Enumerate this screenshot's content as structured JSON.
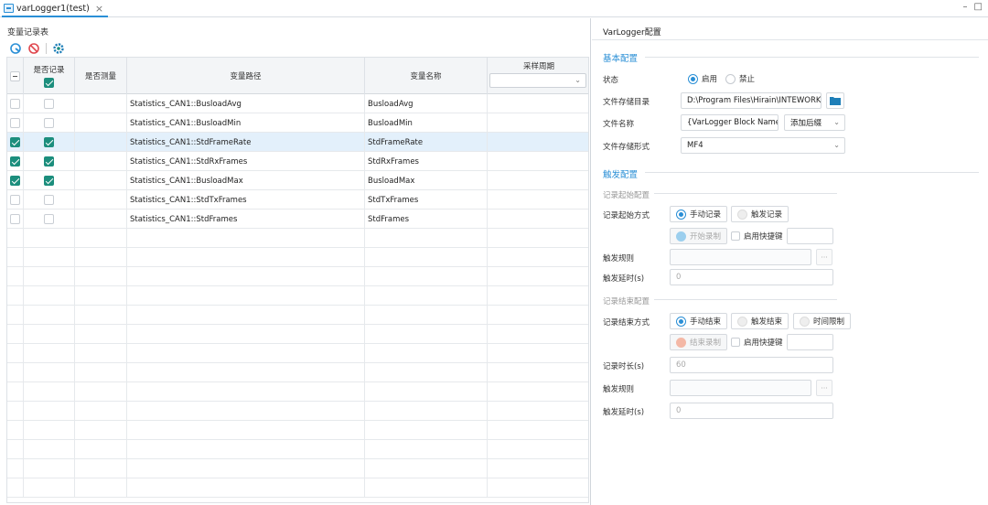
{
  "tab": {
    "title": "varLogger1(test)",
    "close": "×"
  },
  "window": {
    "minimize": "–",
    "maximize": "□"
  },
  "left": {
    "title": "变量记录表",
    "columns": {
      "record": "是否记录",
      "measure": "是否测量",
      "path": "变量路径",
      "name": "变量名称",
      "period": "采样周期"
    },
    "rows": [
      {
        "measure": false,
        "record": false,
        "path": "Statistics_CAN1::BusloadAvg",
        "name": "BusloadAvg",
        "selected": false
      },
      {
        "measure": false,
        "record": false,
        "path": "Statistics_CAN1::BusloadMin",
        "name": "BusloadMin",
        "selected": false
      },
      {
        "measure": true,
        "record": true,
        "path": "Statistics_CAN1::StdFrameRate",
        "name": "StdFrameRate",
        "selected": true
      },
      {
        "measure": true,
        "record": true,
        "path": "Statistics_CAN1::StdRxFrames",
        "name": "StdRxFrames",
        "selected": false
      },
      {
        "measure": true,
        "record": true,
        "path": "Statistics_CAN1::BusloadMax",
        "name": "BusloadMax",
        "selected": false
      },
      {
        "measure": false,
        "record": false,
        "path": "Statistics_CAN1::StdTxFrames",
        "name": "StdTxFrames",
        "selected": false
      },
      {
        "measure": false,
        "record": false,
        "path": "Statistics_CAN1::StdFrames",
        "name": "StdFrames",
        "selected": false
      }
    ]
  },
  "right": {
    "title": "VarLogger配置",
    "basic": {
      "section": "基本配置",
      "status_label": "状态",
      "status_on": "启用",
      "status_off": "禁止",
      "dir_label": "文件存储目录",
      "dir_value": "D:\\Program Files\\Hirain\\INTEWORK\\V",
      "name_label": "文件名称",
      "name_value": "{VarLogger Block Name}_",
      "suffix": "添加后缀",
      "format_label": "文件存储形式",
      "format_value": "MF4"
    },
    "trigger": {
      "section": "触发配置",
      "start_sub": "记录起始配置",
      "start_mode_label": "记录起始方式",
      "start_manual": "手动记录",
      "start_trigger": "触发记录",
      "start_record": "开始录制",
      "start_hotkey": "启用快捷键",
      "rule_label": "触发规则",
      "dots": "···",
      "delay_label": "触发延时(s)",
      "delay_value": "0",
      "end_sub": "记录结束配置",
      "end_mode_label": "记录结束方式",
      "end_manual": "手动结束",
      "end_trigger": "触发结束",
      "end_time": "时间限制",
      "end_record": "结束录制",
      "end_hotkey": "启用快捷键",
      "duration_label": "记录时长(s)",
      "duration_value": "60",
      "rule2_label": "触发规则",
      "delay2_label": "触发延时(s)",
      "delay2_value": "0"
    }
  },
  "colors": {
    "accent": "#2a8fd6",
    "check": "#1c8e7d",
    "stop": "#e0484f"
  }
}
